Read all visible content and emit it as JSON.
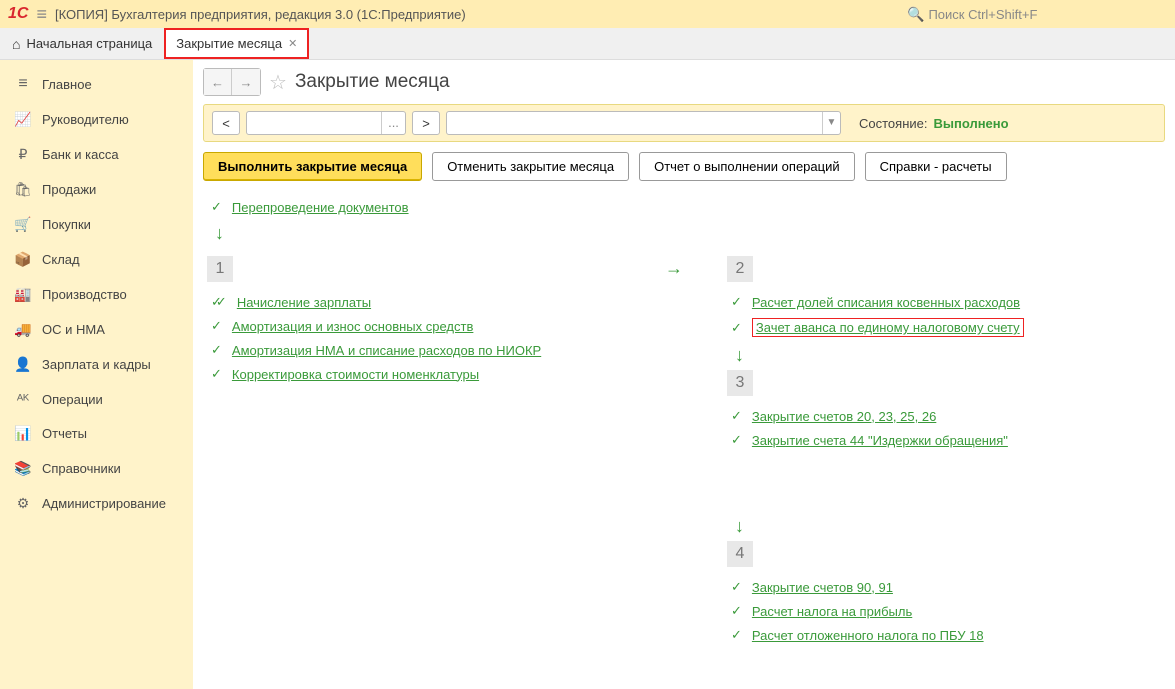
{
  "titlebar": {
    "logo": "1C",
    "title": "[КОПИЯ] Бухгалтерия предприятия, редакция 3.0  (1С:Предприятие)",
    "search_placeholder": "Поиск Ctrl+Shift+F"
  },
  "tabs": {
    "home_label": "Начальная страница",
    "active_tab_label": "Закрытие месяца"
  },
  "sidebar": {
    "items": [
      {
        "icon": "≡",
        "label": "Главное"
      },
      {
        "icon": "📈",
        "label": "Руководителю"
      },
      {
        "icon": "₽",
        "label": "Банк и касса"
      },
      {
        "icon": "🛍",
        "label": "Продажи"
      },
      {
        "icon": "🛒",
        "label": "Покупки"
      },
      {
        "icon": "📦",
        "label": "Склад"
      },
      {
        "icon": "🏭",
        "label": "Производство"
      },
      {
        "icon": "🚚",
        "label": "ОС и НМА"
      },
      {
        "icon": "👤",
        "label": "Зарплата и кадры"
      },
      {
        "icon": "ᴬᴷ",
        "label": "Операции"
      },
      {
        "icon": "📊",
        "label": "Отчеты"
      },
      {
        "icon": "📚",
        "label": "Справочники"
      },
      {
        "icon": "⚙",
        "label": "Администрирование"
      }
    ]
  },
  "page": {
    "title": "Закрытие месяца",
    "state_label": "Состояние:",
    "state_value": "Выполнено"
  },
  "toolbar": {
    "prev": "<",
    "next": ">",
    "dots": "...",
    "dropdown": "▼"
  },
  "actions": {
    "execute": "Выполнить закрытие месяца",
    "cancel": "Отменить закрытие месяца",
    "report": "Отчет о выполнении операций",
    "refs": "Справки - расчеты"
  },
  "top_op": "Перепроведение документов",
  "stage1": [
    "Начисление зарплаты",
    "Амортизация и износ основных средств",
    "Амортизация НМА и списание расходов по НИОКР",
    "Корректировка стоимости номенклатуры"
  ],
  "stage2": [
    "Расчет долей списания косвенных расходов",
    "Зачет аванса по единому налоговому счету"
  ],
  "stage3": [
    "Закрытие счетов 20, 23, 25, 26",
    "Закрытие счета 44 \"Издержки обращения\""
  ],
  "stage4": [
    "Закрытие счетов 90, 91",
    "Расчет налога на прибыль",
    "Расчет отложенного налога по ПБУ 18"
  ],
  "nums": {
    "s1": "1",
    "s2": "2",
    "s3": "3",
    "s4": "4"
  }
}
